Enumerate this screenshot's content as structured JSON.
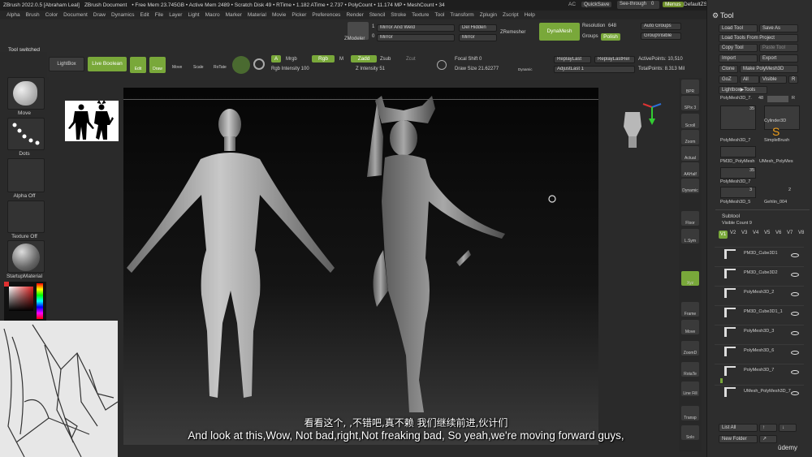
{
  "titlebar": {
    "app": "ZBrush 2022.0.5 [Abraham Leal]",
    "doc": "ZBrush Document",
    "stats": "• Free Mem 23.745GB • Active Mem 2489 • Scratch Disk 49 • RTime • 1.182 ATime • 2.737 • PolyCount • 11.174 MP • MeshCount • 34",
    "ac": "AC",
    "quicksave": "QuickSave",
    "see_through": "See-through",
    "see_through_val": "0",
    "menus": "Menus",
    "script": "DefaultZScript"
  },
  "menubar": [
    "Alpha",
    "Brush",
    "Color",
    "Document",
    "Draw",
    "Dynamics",
    "Edit",
    "File",
    "Layer",
    "Light",
    "Macro",
    "Marker",
    "Material",
    "Movie",
    "Picker",
    "Preferences",
    "Render",
    "Stencil",
    "Stroke",
    "Texture",
    "Tool",
    "Transform",
    "Zplugin",
    "Zscript",
    "Help"
  ],
  "topctrl": {
    "zmodeler": "ZModeler",
    "num1": "1",
    "num0": "0",
    "mirror_weld": "Mirror And Weld",
    "mirror": "Mirror",
    "del_hidden": "Del Hidden",
    "mirror2": "Mirror",
    "zremesher": "ZRemesher",
    "dynamesh": "DynaMesh",
    "resolution_label": "Resolution",
    "resolution_val": "648",
    "groups": "Groups",
    "polish": "Polish",
    "auto_groups": "Auto Groups",
    "group_visible": "GroupVisible"
  },
  "toolbar": {
    "tool_switched": "Tool switched",
    "lightbox": "LightBox",
    "live_boolean": "Live Boolean",
    "edit": "Edit",
    "draw": "Draw",
    "move": "Move",
    "scale": "Scale",
    "rotate": "RoTate",
    "a": "A",
    "mrgb": "Mrgb",
    "rgb": "Rgb",
    "m": "M",
    "zadd": "Zadd",
    "zsub": "Zsub",
    "zcut": "Zcut",
    "rgb_intensity": "Rgb Intensity 100",
    "z_intensity": "Z Intensity 51",
    "focal_shift": "Focal Shift 0",
    "draw_size": "Draw Size 21.62277",
    "dynamic": "Dynamic",
    "replay_last": "ReplayLast",
    "replay_last_rel": "ReplayLastRel",
    "adjust_last": "AdjustLast 1",
    "active_points": "ActivePoints: 10,510",
    "total_points": "TotalPoints: 8.313 Mil"
  },
  "leftcol": {
    "move": "Move",
    "dots": "Dots",
    "alpha_off": "Alpha Off",
    "texture_off": "Texture Off",
    "startup_material": "StartupMaterial"
  },
  "shelf": [
    "BPR",
    "SPix 3",
    "Scroll",
    "Zoom",
    "Actual",
    "AAHalf",
    "Dynamic Persp",
    "Floor",
    "L.Sym",
    "Xyz",
    "Frame",
    "Move",
    "ZoomD",
    "RotaTe",
    "Line Fill PolyF",
    "Transp",
    "Solo"
  ],
  "tool": {
    "title": "Tool",
    "load_tool": "Load Tool",
    "save_as": "Save As",
    "load_from_project": "Load Tools From Project",
    "copy_tool": "Copy Tool",
    "paste_tool": "Paste Tool",
    "import": "Import",
    "export": "Export",
    "clone": "Clone",
    "make_polymesh": "Make PolyMesh3D",
    "goz": "GoZ",
    "all": "All",
    "visible": "Visible",
    "r": "R",
    "lightbox_tools": "Lightbox▶Tools",
    "current_tool": "PolyMesh3D_7.",
    "current_num": "48",
    "r2": "R",
    "thumbs": [
      {
        "label": "PolyMesh3D_7",
        "count": "35"
      },
      {
        "label": "Cylinder3D",
        "count": ""
      },
      {
        "label": "SimpleBrush",
        "count": ""
      },
      {
        "label": "PM3D_PolyMesh",
        "count": ""
      },
      {
        "label": "UMesh_PolyMes",
        "count": ""
      },
      {
        "label": "PolyMesh3D_7",
        "count": "35"
      },
      {
        "label": "PolyMesh3D_5",
        "count": "3"
      },
      {
        "label": "Gehlin_004",
        "count": "2"
      }
    ]
  },
  "subtool": {
    "title": "Subtool",
    "visible_count": "Visible Count 9",
    "versions": [
      "V1",
      "V2",
      "V3",
      "V4",
      "V5",
      "V6",
      "V7",
      "V8"
    ],
    "items": [
      "PM3D_Cube3D1",
      "PM3D_Cube3D2",
      "PolyMesh3D_2",
      "PM3D_Cube3D1_1",
      "PolyMesh3D_3",
      "PolyMesh3D_6",
      "PolyMesh3D_7",
      "UMesh_PolyMesh3D_7"
    ],
    "list_all": "List All",
    "new_folder": "New Folder"
  },
  "subtitle": {
    "cn": "看看这个, ,不错吧,真不赖 我们继续前进,伙计们",
    "en": "And look at this,Wow, Not bad,right,Not freaking bad, So yeah,we're moving forward guys,"
  },
  "watermark": "ūdemy",
  "colors": {
    "accent_green": "#79a83a",
    "panel": "#2d2d2d",
    "canvas": "#0a0a0a"
  }
}
